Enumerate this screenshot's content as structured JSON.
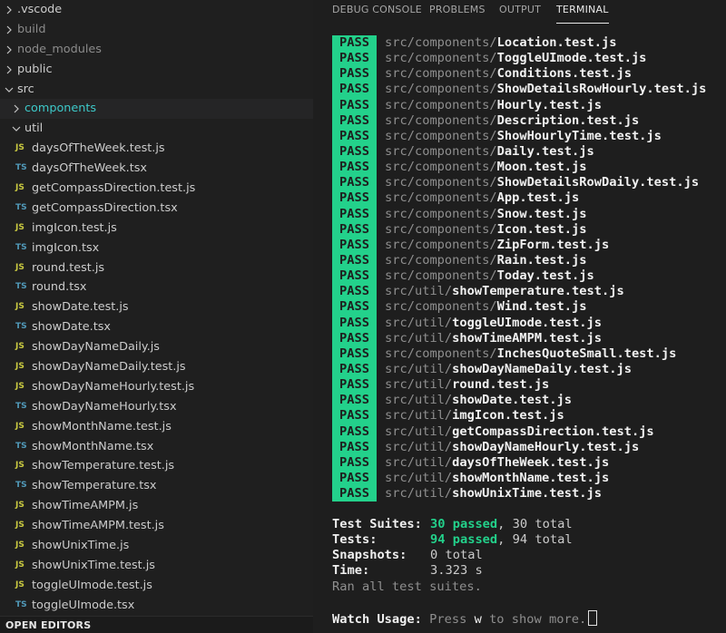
{
  "explorer": {
    "rows": [
      {
        "label": ".vscode",
        "kind": "folder",
        "state": "collapsed",
        "indent": 0
      },
      {
        "label": "build",
        "kind": "folder",
        "state": "collapsed",
        "indent": 0,
        "dim": true
      },
      {
        "label": "node_modules",
        "kind": "folder",
        "state": "collapsed",
        "indent": 0,
        "dim": true
      },
      {
        "label": "public",
        "kind": "folder",
        "state": "collapsed",
        "indent": 0
      },
      {
        "label": "src",
        "kind": "folder",
        "state": "expanded",
        "indent": 0
      },
      {
        "label": "components",
        "kind": "folder",
        "state": "collapsed",
        "indent": 1,
        "accent": true,
        "selected": true
      },
      {
        "label": "util",
        "kind": "folder",
        "state": "expanded",
        "indent": 1
      },
      {
        "label": "daysOfTheWeek.test.js",
        "kind": "file",
        "badge": "JS",
        "indent": 2
      },
      {
        "label": "daysOfTheWeek.tsx",
        "kind": "file",
        "badge": "TS",
        "indent": 2
      },
      {
        "label": "getCompassDirection.test.js",
        "kind": "file",
        "badge": "JS",
        "indent": 2
      },
      {
        "label": "getCompassDirection.tsx",
        "kind": "file",
        "badge": "TS",
        "indent": 2
      },
      {
        "label": "imgIcon.test.js",
        "kind": "file",
        "badge": "JS",
        "indent": 2
      },
      {
        "label": "imgIcon.tsx",
        "kind": "file",
        "badge": "TS",
        "indent": 2
      },
      {
        "label": "round.test.js",
        "kind": "file",
        "badge": "JS",
        "indent": 2
      },
      {
        "label": "round.tsx",
        "kind": "file",
        "badge": "TS",
        "indent": 2
      },
      {
        "label": "showDate.test.js",
        "kind": "file",
        "badge": "JS",
        "indent": 2
      },
      {
        "label": "showDate.tsx",
        "kind": "file",
        "badge": "TS",
        "indent": 2
      },
      {
        "label": "showDayNameDaily.js",
        "kind": "file",
        "badge": "JS",
        "indent": 2
      },
      {
        "label": "showDayNameDaily.test.js",
        "kind": "file",
        "badge": "JS",
        "indent": 2
      },
      {
        "label": "showDayNameHourly.test.js",
        "kind": "file",
        "badge": "JS",
        "indent": 2
      },
      {
        "label": "showDayNameHourly.tsx",
        "kind": "file",
        "badge": "TS",
        "indent": 2
      },
      {
        "label": "showMonthName.test.js",
        "kind": "file",
        "badge": "JS",
        "indent": 2
      },
      {
        "label": "showMonthName.tsx",
        "kind": "file",
        "badge": "TS",
        "indent": 2
      },
      {
        "label": "showTemperature.test.js",
        "kind": "file",
        "badge": "JS",
        "indent": 2
      },
      {
        "label": "showTemperature.tsx",
        "kind": "file",
        "badge": "TS",
        "indent": 2
      },
      {
        "label": "showTimeAMPM.js",
        "kind": "file",
        "badge": "JS",
        "indent": 2
      },
      {
        "label": "showTimeAMPM.test.js",
        "kind": "file",
        "badge": "JS",
        "indent": 2
      },
      {
        "label": "showUnixTime.js",
        "kind": "file",
        "badge": "JS",
        "indent": 2
      },
      {
        "label": "showUnixTime.test.js",
        "kind": "file",
        "badge": "JS",
        "indent": 2
      },
      {
        "label": "toggleUImode.test.js",
        "kind": "file",
        "badge": "JS",
        "indent": 2
      },
      {
        "label": "toggleUImode.tsx",
        "kind": "file",
        "badge": "TS",
        "indent": 2
      }
    ],
    "open_editors_label": "OPEN EDITORS"
  },
  "panel": {
    "tabs": [
      {
        "label": "DEBUG CONSOLE",
        "active": false
      },
      {
        "label": "PROBLEMS",
        "active": false
      },
      {
        "label": "OUTPUT",
        "active": false
      },
      {
        "label": "TERMINAL",
        "active": true
      }
    ]
  },
  "terminal": {
    "results": [
      {
        "status": "PASS",
        "dir": "src/components/",
        "file": "Location.test.js"
      },
      {
        "status": "PASS",
        "dir": "src/components/",
        "file": "ToggleUImode.test.js"
      },
      {
        "status": "PASS",
        "dir": "src/components/",
        "file": "Conditions.test.js"
      },
      {
        "status": "PASS",
        "dir": "src/components/",
        "file": "ShowDetailsRowHourly.test.js"
      },
      {
        "status": "PASS",
        "dir": "src/components/",
        "file": "Hourly.test.js"
      },
      {
        "status": "PASS",
        "dir": "src/components/",
        "file": "Description.test.js"
      },
      {
        "status": "PASS",
        "dir": "src/components/",
        "file": "ShowHourlyTime.test.js"
      },
      {
        "status": "PASS",
        "dir": "src/components/",
        "file": "Daily.test.js"
      },
      {
        "status": "PASS",
        "dir": "src/components/",
        "file": "Moon.test.js"
      },
      {
        "status": "PASS",
        "dir": "src/components/",
        "file": "ShowDetailsRowDaily.test.js"
      },
      {
        "status": "PASS",
        "dir": "src/components/",
        "file": "App.test.js"
      },
      {
        "status": "PASS",
        "dir": "src/components/",
        "file": "Snow.test.js"
      },
      {
        "status": "PASS",
        "dir": "src/components/",
        "file": "Icon.test.js"
      },
      {
        "status": "PASS",
        "dir": "src/components/",
        "file": "ZipForm.test.js"
      },
      {
        "status": "PASS",
        "dir": "src/components/",
        "file": "Rain.test.js"
      },
      {
        "status": "PASS",
        "dir": "src/components/",
        "file": "Today.test.js"
      },
      {
        "status": "PASS",
        "dir": "src/util/",
        "file": "showTemperature.test.js"
      },
      {
        "status": "PASS",
        "dir": "src/components/",
        "file": "Wind.test.js"
      },
      {
        "status": "PASS",
        "dir": "src/util/",
        "file": "toggleUImode.test.js"
      },
      {
        "status": "PASS",
        "dir": "src/util/",
        "file": "showTimeAMPM.test.js"
      },
      {
        "status": "PASS",
        "dir": "src/components/",
        "file": "InchesQuoteSmall.test.js"
      },
      {
        "status": "PASS",
        "dir": "src/util/",
        "file": "showDayNameDaily.test.js"
      },
      {
        "status": "PASS",
        "dir": "src/util/",
        "file": "round.test.js"
      },
      {
        "status": "PASS",
        "dir": "src/util/",
        "file": "showDate.test.js"
      },
      {
        "status": "PASS",
        "dir": "src/util/",
        "file": "imgIcon.test.js"
      },
      {
        "status": "PASS",
        "dir": "src/util/",
        "file": "getCompassDirection.test.js"
      },
      {
        "status": "PASS",
        "dir": "src/util/",
        "file": "showDayNameHourly.test.js"
      },
      {
        "status": "PASS",
        "dir": "src/util/",
        "file": "daysOfTheWeek.test.js"
      },
      {
        "status": "PASS",
        "dir": "src/util/",
        "file": "showMonthName.test.js"
      },
      {
        "status": "PASS",
        "dir": "src/util/",
        "file": "showUnixTime.test.js"
      }
    ],
    "summary": {
      "suites_label": "Test Suites:",
      "suites_passed": "30 passed",
      "suites_total": ", 30 total",
      "tests_label": "Tests:",
      "tests_passed": "94 passed",
      "tests_total": ", 94 total",
      "snapshots_label": "Snapshots:",
      "snapshots_value": "0 total",
      "time_label": "Time:",
      "time_value": "3.323 s",
      "ran_all": "Ran all test suites."
    },
    "watch": {
      "label": "Watch Usage:",
      "press": " Press ",
      "key": "w",
      "rest": " to show more."
    }
  },
  "colors": {
    "pass_bg": "#23d18b",
    "js_badge": "#cbcb41",
    "ts_badge": "#519aba",
    "folder_accent": "#3dc9c9"
  },
  "icons": {
    "chevron_right": "chevron-right-icon",
    "chevron_down": "chevron-down-icon",
    "js_file": "js-file-icon",
    "ts_file": "ts-file-icon"
  }
}
